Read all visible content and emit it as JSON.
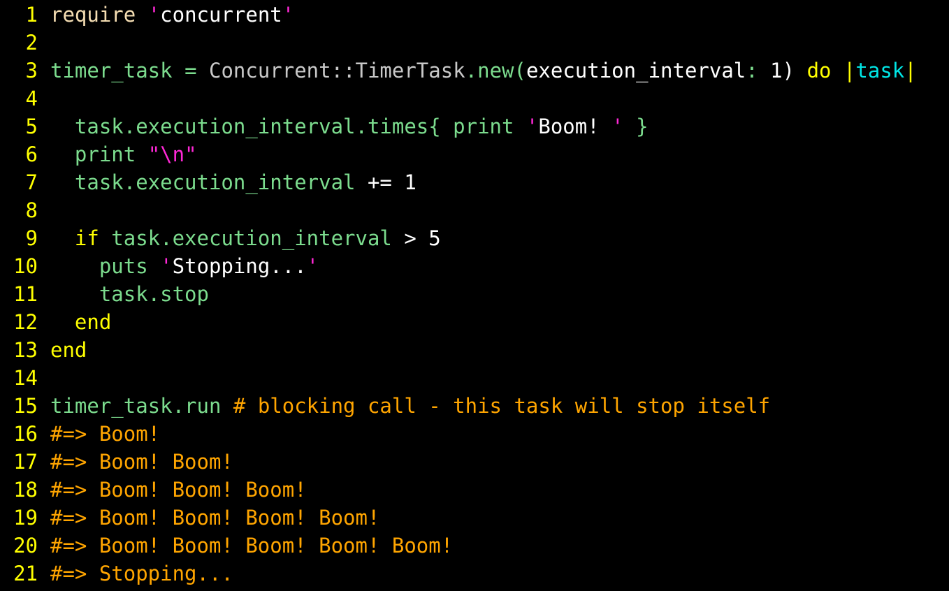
{
  "editor": {
    "background": "#000000",
    "colors": {
      "line_number": "#ffff00",
      "method": "#7cdc8e",
      "keyword": "#ffff00",
      "string_delim": "#ff28d6",
      "string": "#ffffff",
      "constant": "#c8c8c8",
      "number": "#ffffff",
      "comment": "#ffa500",
      "param": "#00e5e5",
      "plain": "#ffffff"
    },
    "lines": [
      {
        "n": "1",
        "tokens": [
          {
            "t": "require",
            "c": "#f5deb3"
          },
          {
            "t": " ",
            "c": "#ffffff"
          },
          {
            "t": "'",
            "c": "#ff28d6"
          },
          {
            "t": "concurrent",
            "c": "#ffffff"
          },
          {
            "t": "'",
            "c": "#ff28d6"
          }
        ]
      },
      {
        "n": "2",
        "tokens": []
      },
      {
        "n": "3",
        "tokens": [
          {
            "t": "timer_task",
            "c": "#7cdc8e"
          },
          {
            "t": " = ",
            "c": "#7cdc8e"
          },
          {
            "t": "Concurrent::TimerTask",
            "c": "#c8c8c8"
          },
          {
            "t": ".new(",
            "c": "#7cdc8e"
          },
          {
            "t": "execution_interval",
            "c": "#ffffff"
          },
          {
            "t": ": ",
            "c": "#7cdc8e"
          },
          {
            "t": "1",
            "c": "#ffffff"
          },
          {
            "t": ") ",
            "c": "#ffffff"
          },
          {
            "t": "do",
            "c": "#ffff00"
          },
          {
            "t": " |",
            "c": "#ffff00"
          },
          {
            "t": "task",
            "c": "#00e5e5"
          },
          {
            "t": "|",
            "c": "#ffff00"
          }
        ]
      },
      {
        "n": "4",
        "tokens": []
      },
      {
        "n": "5",
        "tokens": [
          {
            "t": "  task.execution_interval.times{ print ",
            "c": "#7cdc8e"
          },
          {
            "t": "'",
            "c": "#ff28d6"
          },
          {
            "t": "Boom! ",
            "c": "#ffffff"
          },
          {
            "t": "'",
            "c": "#ff28d6"
          },
          {
            "t": " }",
            "c": "#7cdc8e"
          }
        ]
      },
      {
        "n": "6",
        "tokens": [
          {
            "t": "  print ",
            "c": "#7cdc8e"
          },
          {
            "t": "\"\\n\"",
            "c": "#ff28d6"
          }
        ]
      },
      {
        "n": "7",
        "tokens": [
          {
            "t": "  task.execution_interval ",
            "c": "#7cdc8e"
          },
          {
            "t": "+=",
            "c": "#ffffff"
          },
          {
            "t": " ",
            "c": "#ffffff"
          },
          {
            "t": "1",
            "c": "#ffffff"
          }
        ]
      },
      {
        "n": "8",
        "tokens": []
      },
      {
        "n": "9",
        "tokens": [
          {
            "t": "  if",
            "c": "#ffff00"
          },
          {
            "t": " task.execution_interval ",
            "c": "#7cdc8e"
          },
          {
            "t": ">",
            "c": "#ffffff"
          },
          {
            "t": " ",
            "c": "#ffffff"
          },
          {
            "t": "5",
            "c": "#ffffff"
          }
        ]
      },
      {
        "n": "10",
        "tokens": [
          {
            "t": "    puts ",
            "c": "#7cdc8e"
          },
          {
            "t": "'",
            "c": "#ff28d6"
          },
          {
            "t": "Stopping...",
            "c": "#ffffff"
          },
          {
            "t": "'",
            "c": "#ff28d6"
          }
        ]
      },
      {
        "n": "11",
        "tokens": [
          {
            "t": "    task.stop",
            "c": "#7cdc8e"
          }
        ]
      },
      {
        "n": "12",
        "tokens": [
          {
            "t": "  end",
            "c": "#ffff00"
          }
        ]
      },
      {
        "n": "13",
        "tokens": [
          {
            "t": "end",
            "c": "#ffff00"
          }
        ]
      },
      {
        "n": "14",
        "tokens": []
      },
      {
        "n": "15",
        "tokens": [
          {
            "t": "timer_task.run ",
            "c": "#7cdc8e"
          },
          {
            "t": "# blocking call - this task will stop itself",
            "c": "#ffa500"
          }
        ]
      },
      {
        "n": "16",
        "tokens": [
          {
            "t": "#=> Boom!",
            "c": "#ffa500"
          }
        ]
      },
      {
        "n": "17",
        "tokens": [
          {
            "t": "#=> Boom! Boom!",
            "c": "#ffa500"
          }
        ]
      },
      {
        "n": "18",
        "tokens": [
          {
            "t": "#=> Boom! Boom! Boom!",
            "c": "#ffa500"
          }
        ]
      },
      {
        "n": "19",
        "tokens": [
          {
            "t": "#=> Boom! Boom! Boom! Boom!",
            "c": "#ffa500"
          }
        ]
      },
      {
        "n": "20",
        "tokens": [
          {
            "t": "#=> Boom! Boom! Boom! Boom! Boom!",
            "c": "#ffa500"
          }
        ]
      },
      {
        "n": "21",
        "tokens": [
          {
            "t": "#=> Stopping...",
            "c": "#ffa500"
          }
        ]
      }
    ]
  }
}
